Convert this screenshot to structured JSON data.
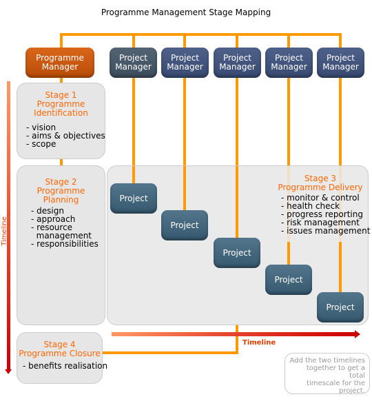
{
  "title": "Programme Management Stage Mapping",
  "colors": {
    "connector": "#ff9900",
    "stage_title": "#ff6600",
    "stage_bg": "#e6e6e6",
    "programme_manager": "#c4560d",
    "project_manager": "#3c4f79",
    "project": "#3e6179",
    "timeline_start": "#ff9966",
    "timeline_end": "#cc0000"
  },
  "programme_manager": {
    "label_line1": "Programme",
    "label_line2": "Manager"
  },
  "project_managers": [
    {
      "line1": "Project",
      "line2": "Manager"
    },
    {
      "line1": "Project",
      "line2": "Manager"
    },
    {
      "line1": "Project",
      "line2": "Manager"
    },
    {
      "line1": "Project",
      "line2": "Manager"
    },
    {
      "line1": "Project",
      "line2": "Manager"
    }
  ],
  "projects": [
    {
      "label": "Project"
    },
    {
      "label": "Project"
    },
    {
      "label": "Project"
    },
    {
      "label": "Project"
    },
    {
      "label": "Project"
    }
  ],
  "stages": [
    {
      "title1": "Stage 1",
      "title2": "Programme",
      "title3": "Identification",
      "items": [
        "- vision",
        "- aims & objectives",
        "- scope"
      ]
    },
    {
      "title1": "Stage 2",
      "title2": "Programme",
      "title3": "Planning",
      "items": [
        "- design",
        "- approach",
        "- resource",
        "  management",
        "- responsibilities"
      ]
    },
    {
      "title1": "Stage 3",
      "title2": "Programme Delivery",
      "items": [
        "- monitor & control",
        "- health check",
        "- progress reporting",
        "- risk management",
        "- issues management"
      ]
    },
    {
      "title1": "Stage 4",
      "title2": "Programme Closure",
      "items": [
        "- benefits realisation"
      ]
    }
  ],
  "timeline_vertical_label": "Timeline",
  "timeline_horizontal_label": "Timeline",
  "note": {
    "line1": "Add the two timelines",
    "line2": "together to get a total",
    "line3": "timescale for the",
    "line4": "project."
  }
}
